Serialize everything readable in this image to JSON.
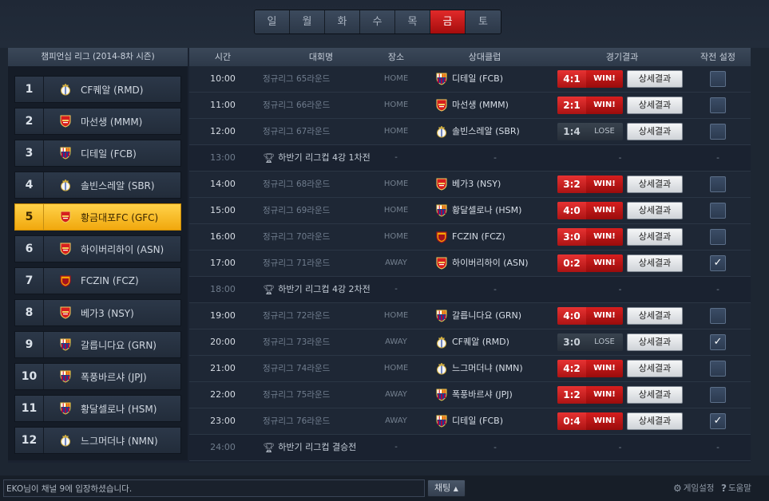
{
  "colors": {
    "accent_red": "#d61e1e",
    "highlight_gold": "#f1a80d",
    "background": "#1d2632"
  },
  "day_tabs": [
    {
      "label": "일",
      "active": false
    },
    {
      "label": "월",
      "active": false
    },
    {
      "label": "화",
      "active": false
    },
    {
      "label": "수",
      "active": false
    },
    {
      "label": "목",
      "active": false
    },
    {
      "label": "금",
      "active": true
    },
    {
      "label": "토",
      "active": false
    }
  ],
  "league": {
    "title": "챔피언십 리그 (2014-8차 시즌)",
    "standings": [
      {
        "rank": "1",
        "name": "CF퀘알 (RMD)",
        "crest": "real-crest-icon",
        "highlight": false
      },
      {
        "rank": "2",
        "name": "마선생 (MMM)",
        "crest": "arsenal-crest-icon",
        "highlight": false
      },
      {
        "rank": "3",
        "name": "디테일 (FCB)",
        "crest": "barca-crest-icon",
        "highlight": false
      },
      {
        "rank": "4",
        "name": "솔빈스레알 (SBR)",
        "crest": "real-crest-icon",
        "highlight": false
      },
      {
        "rank": "5",
        "name": "황금대포FC (GFC)",
        "crest": "arsenal-crest-icon",
        "highlight": true
      },
      {
        "rank": "6",
        "name": "하이버리하이 (ASN)",
        "crest": "arsenal-crest-icon",
        "highlight": false
      },
      {
        "rank": "7",
        "name": "FCZIN (FCZ)",
        "crest": "gala-crest-icon",
        "highlight": false
      },
      {
        "rank": "8",
        "name": "베가3 (NSY)",
        "crest": "arsenal-crest-icon",
        "highlight": false
      },
      {
        "rank": "9",
        "name": "갈릅니다요 (GRN)",
        "crest": "barca-crest-icon",
        "highlight": false
      },
      {
        "rank": "10",
        "name": "폭풍바르샤 (JPJ)",
        "crest": "barca-crest-icon",
        "highlight": false
      },
      {
        "rank": "11",
        "name": "황달셀로나 (HSM)",
        "crest": "barca-crest-icon",
        "highlight": false
      },
      {
        "rank": "12",
        "name": "느그머더냐 (NMN)",
        "crest": "real-crest-icon",
        "highlight": false
      }
    ]
  },
  "columns": {
    "time": "시간",
    "competition": "대회명",
    "venue": "장소",
    "opponent": "상대클럽",
    "result": "경기결과",
    "tactics": "작전 설정"
  },
  "detail_label": "상세결과",
  "schedule": [
    {
      "type": "match",
      "time": "10:00",
      "competition": "정규리그 65라운드",
      "venue": "HOME",
      "crest": "barca-crest-icon",
      "opponent": "디테일 (FCB)",
      "score": "4:1",
      "outcome": "WIN!",
      "win": true,
      "checked": false
    },
    {
      "type": "match",
      "time": "11:00",
      "competition": "정규리그 66라운드",
      "venue": "HOME",
      "crest": "arsenal-crest-icon",
      "opponent": "마선생 (MMM)",
      "score": "2:1",
      "outcome": "WIN!",
      "win": true,
      "checked": false
    },
    {
      "type": "match",
      "time": "12:00",
      "competition": "정규리그 67라운드",
      "venue": "HOME",
      "crest": "real-crest-icon",
      "opponent": "솔빈스레알 (SBR)",
      "score": "1:4",
      "outcome": "LOSE",
      "win": false,
      "checked": false
    },
    {
      "type": "cup",
      "time": "13:00",
      "competition": "하반기 리그컵 4강 1차전",
      "venue": "-",
      "opponent": "-",
      "result": "-",
      "tactics": "-"
    },
    {
      "type": "match",
      "time": "14:00",
      "competition": "정규리그 68라운드",
      "venue": "HOME",
      "crest": "arsenal-crest-icon",
      "opponent": "베가3 (NSY)",
      "score": "3:2",
      "outcome": "WIN!",
      "win": true,
      "checked": false
    },
    {
      "type": "match",
      "time": "15:00",
      "competition": "정규리그 69라운드",
      "venue": "HOME",
      "crest": "barca-crest-icon",
      "opponent": "황달셀로나 (HSM)",
      "score": "4:0",
      "outcome": "WIN!",
      "win": true,
      "checked": false
    },
    {
      "type": "match",
      "time": "16:00",
      "competition": "정규리그 70라운드",
      "venue": "HOME",
      "crest": "gala-crest-icon",
      "opponent": "FCZIN (FCZ)",
      "score": "3:0",
      "outcome": "WIN!",
      "win": true,
      "checked": false
    },
    {
      "type": "match",
      "time": "17:00",
      "competition": "정규리그 71라운드",
      "venue": "AWAY",
      "crest": "arsenal-crest-icon",
      "opponent": "하이버리하이 (ASN)",
      "score": "0:2",
      "outcome": "WIN!",
      "win": true,
      "checked": true
    },
    {
      "type": "cup",
      "time": "18:00",
      "competition": "하반기 리그컵 4강 2차전",
      "venue": "-",
      "opponent": "-",
      "result": "-",
      "tactics": "-"
    },
    {
      "type": "match",
      "time": "19:00",
      "competition": "정규리그 72라운드",
      "venue": "HOME",
      "crest": "barca-crest-icon",
      "opponent": "갈릅니다요 (GRN)",
      "score": "4:0",
      "outcome": "WIN!",
      "win": true,
      "checked": false
    },
    {
      "type": "match",
      "time": "20:00",
      "competition": "정규리그 73라운드",
      "venue": "AWAY",
      "crest": "real-crest-icon",
      "opponent": "CF퀘알 (RMD)",
      "score": "3:0",
      "outcome": "LOSE",
      "win": false,
      "checked": true
    },
    {
      "type": "match",
      "time": "21:00",
      "competition": "정규리그 74라운드",
      "venue": "HOME",
      "crest": "real-crest-icon",
      "opponent": "느그머더냐 (NMN)",
      "score": "4:2",
      "outcome": "WIN!",
      "win": true,
      "checked": false
    },
    {
      "type": "match",
      "time": "22:00",
      "competition": "정규리그 75라운드",
      "venue": "AWAY",
      "crest": "barca-crest-icon",
      "opponent": "폭풍바르샤 (JPJ)",
      "score": "1:2",
      "outcome": "WIN!",
      "win": true,
      "checked": false
    },
    {
      "type": "match",
      "time": "23:00",
      "competition": "정규리그 76라운드",
      "venue": "AWAY",
      "crest": "barca-crest-icon",
      "opponent": "디테일 (FCB)",
      "score": "0:4",
      "outcome": "WIN!",
      "win": true,
      "checked": true
    },
    {
      "type": "cup",
      "time": "24:00",
      "competition": "하반기 리그컵 결승전",
      "venue": "-",
      "opponent": "-",
      "result": "-",
      "tactics": "-"
    }
  ],
  "chat": {
    "message": "EKO님이 채널 9에 입장하셨습니다.",
    "button": "채팅",
    "button_icon": "chevron-up-icon"
  },
  "footer": {
    "settings": "게임설정",
    "settings_icon": "gear-icon",
    "help": "도움말",
    "help_icon": "question-icon"
  }
}
